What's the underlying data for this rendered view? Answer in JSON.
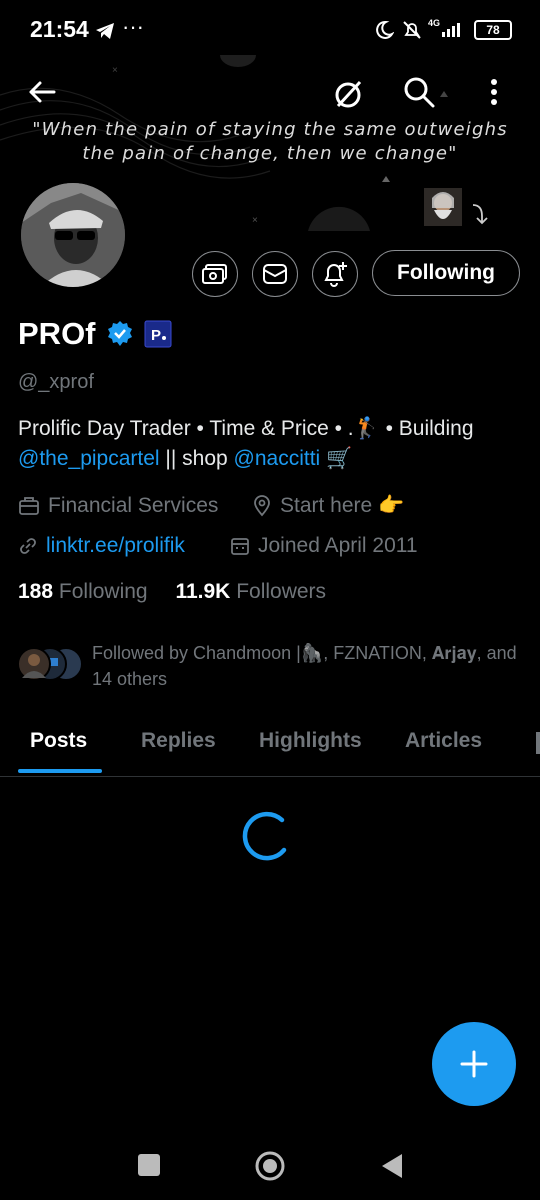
{
  "status_bar": {
    "time": "21:54",
    "battery": "78",
    "network": "4G"
  },
  "header": {
    "quote_line1": "\"When the pain of staying the same outweighs",
    "quote_line2": "the pain of change, then we change\""
  },
  "profile": {
    "name": "PROf",
    "handle": "@_xprof",
    "bio_part1": "Prolific Day Trader • Time & Price • .🏌️ • Building",
    "bio_mention1": "@the_pipcartel",
    "bio_mid": " || shop ",
    "bio_mention2": "@naccitti",
    "bio_end": " 🛒",
    "category": "Financial Services",
    "location": "Start here 👉",
    "website": "linktr.ee/prolifik",
    "joined": "Joined April 2011",
    "following_count": "188",
    "following_label": "Following",
    "followers_count": "11.9K",
    "followers_label": "Followers",
    "followed_by": "Followed by Chandmoon |🦍, FZNATION, 𝐀𝐫𝐣𝐚𝐲, and 14 others"
  },
  "actions": {
    "following_button": "Following"
  },
  "tabs": [
    {
      "label": "Posts"
    },
    {
      "label": "Replies"
    },
    {
      "label": "Highlights"
    },
    {
      "label": "Articles"
    }
  ],
  "colors": {
    "accent": "#1d9bf0",
    "background": "#000000",
    "muted_text": "#71767b"
  }
}
